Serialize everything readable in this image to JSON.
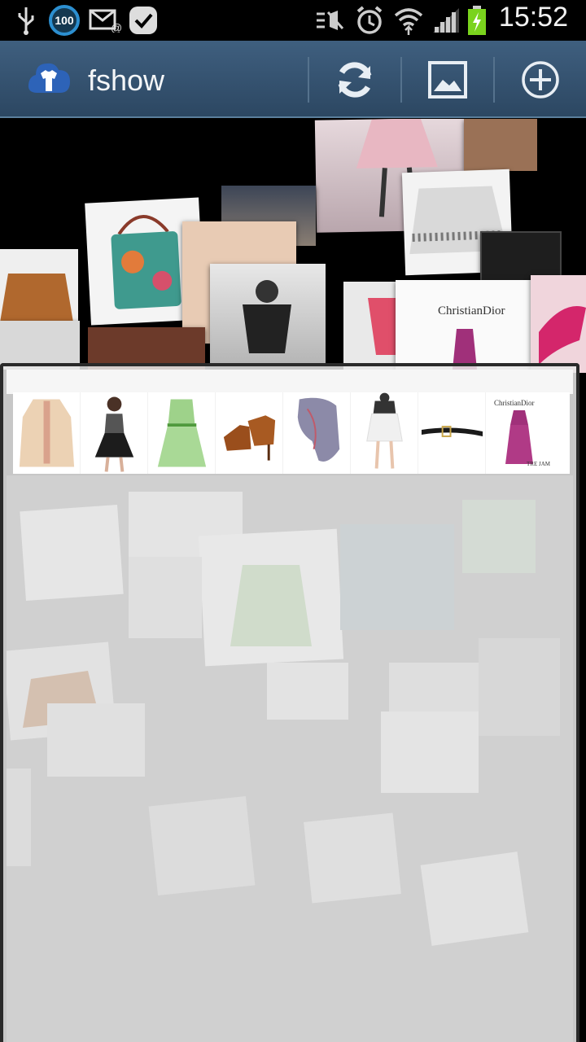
{
  "status_bar": {
    "time": "15:52",
    "battery_badge": "100",
    "icons": [
      "usb-icon",
      "battery-badge",
      "email-icon",
      "task-icon",
      "mute-icon",
      "alarm-icon",
      "wifi-icon",
      "signal-icon",
      "battery-icon"
    ]
  },
  "action_bar": {
    "title": "fshow",
    "buttons": [
      {
        "name": "refresh",
        "icon": "refresh-icon"
      },
      {
        "name": "gallery",
        "icon": "image-icon"
      },
      {
        "name": "add",
        "icon": "add-icon"
      }
    ]
  },
  "gallery": {
    "tile_texts": [
      "ChristianDior"
    ]
  },
  "thumbnails": [
    {
      "item": "blouse",
      "color": "#e9c7a4"
    },
    {
      "item": "dress-model",
      "color": "#2a2a2a"
    },
    {
      "item": "green-dress",
      "color": "#9ed28a"
    },
    {
      "item": "ankle-boots",
      "color": "#9a4e1c"
    },
    {
      "item": "scarf",
      "color": "#8c8aa8"
    },
    {
      "item": "white-skirt",
      "color": "#f0f0f0"
    },
    {
      "item": "belt",
      "color": "#1a1a1a"
    },
    {
      "item": "dior-dress",
      "color": "#a0307a",
      "brand": "ChristianDior",
      "caption": "TRE JAM"
    }
  ],
  "colors": {
    "action_bar": "#3a5874",
    "accent": "#2c8fd0",
    "panel": "#e8e8e8"
  }
}
